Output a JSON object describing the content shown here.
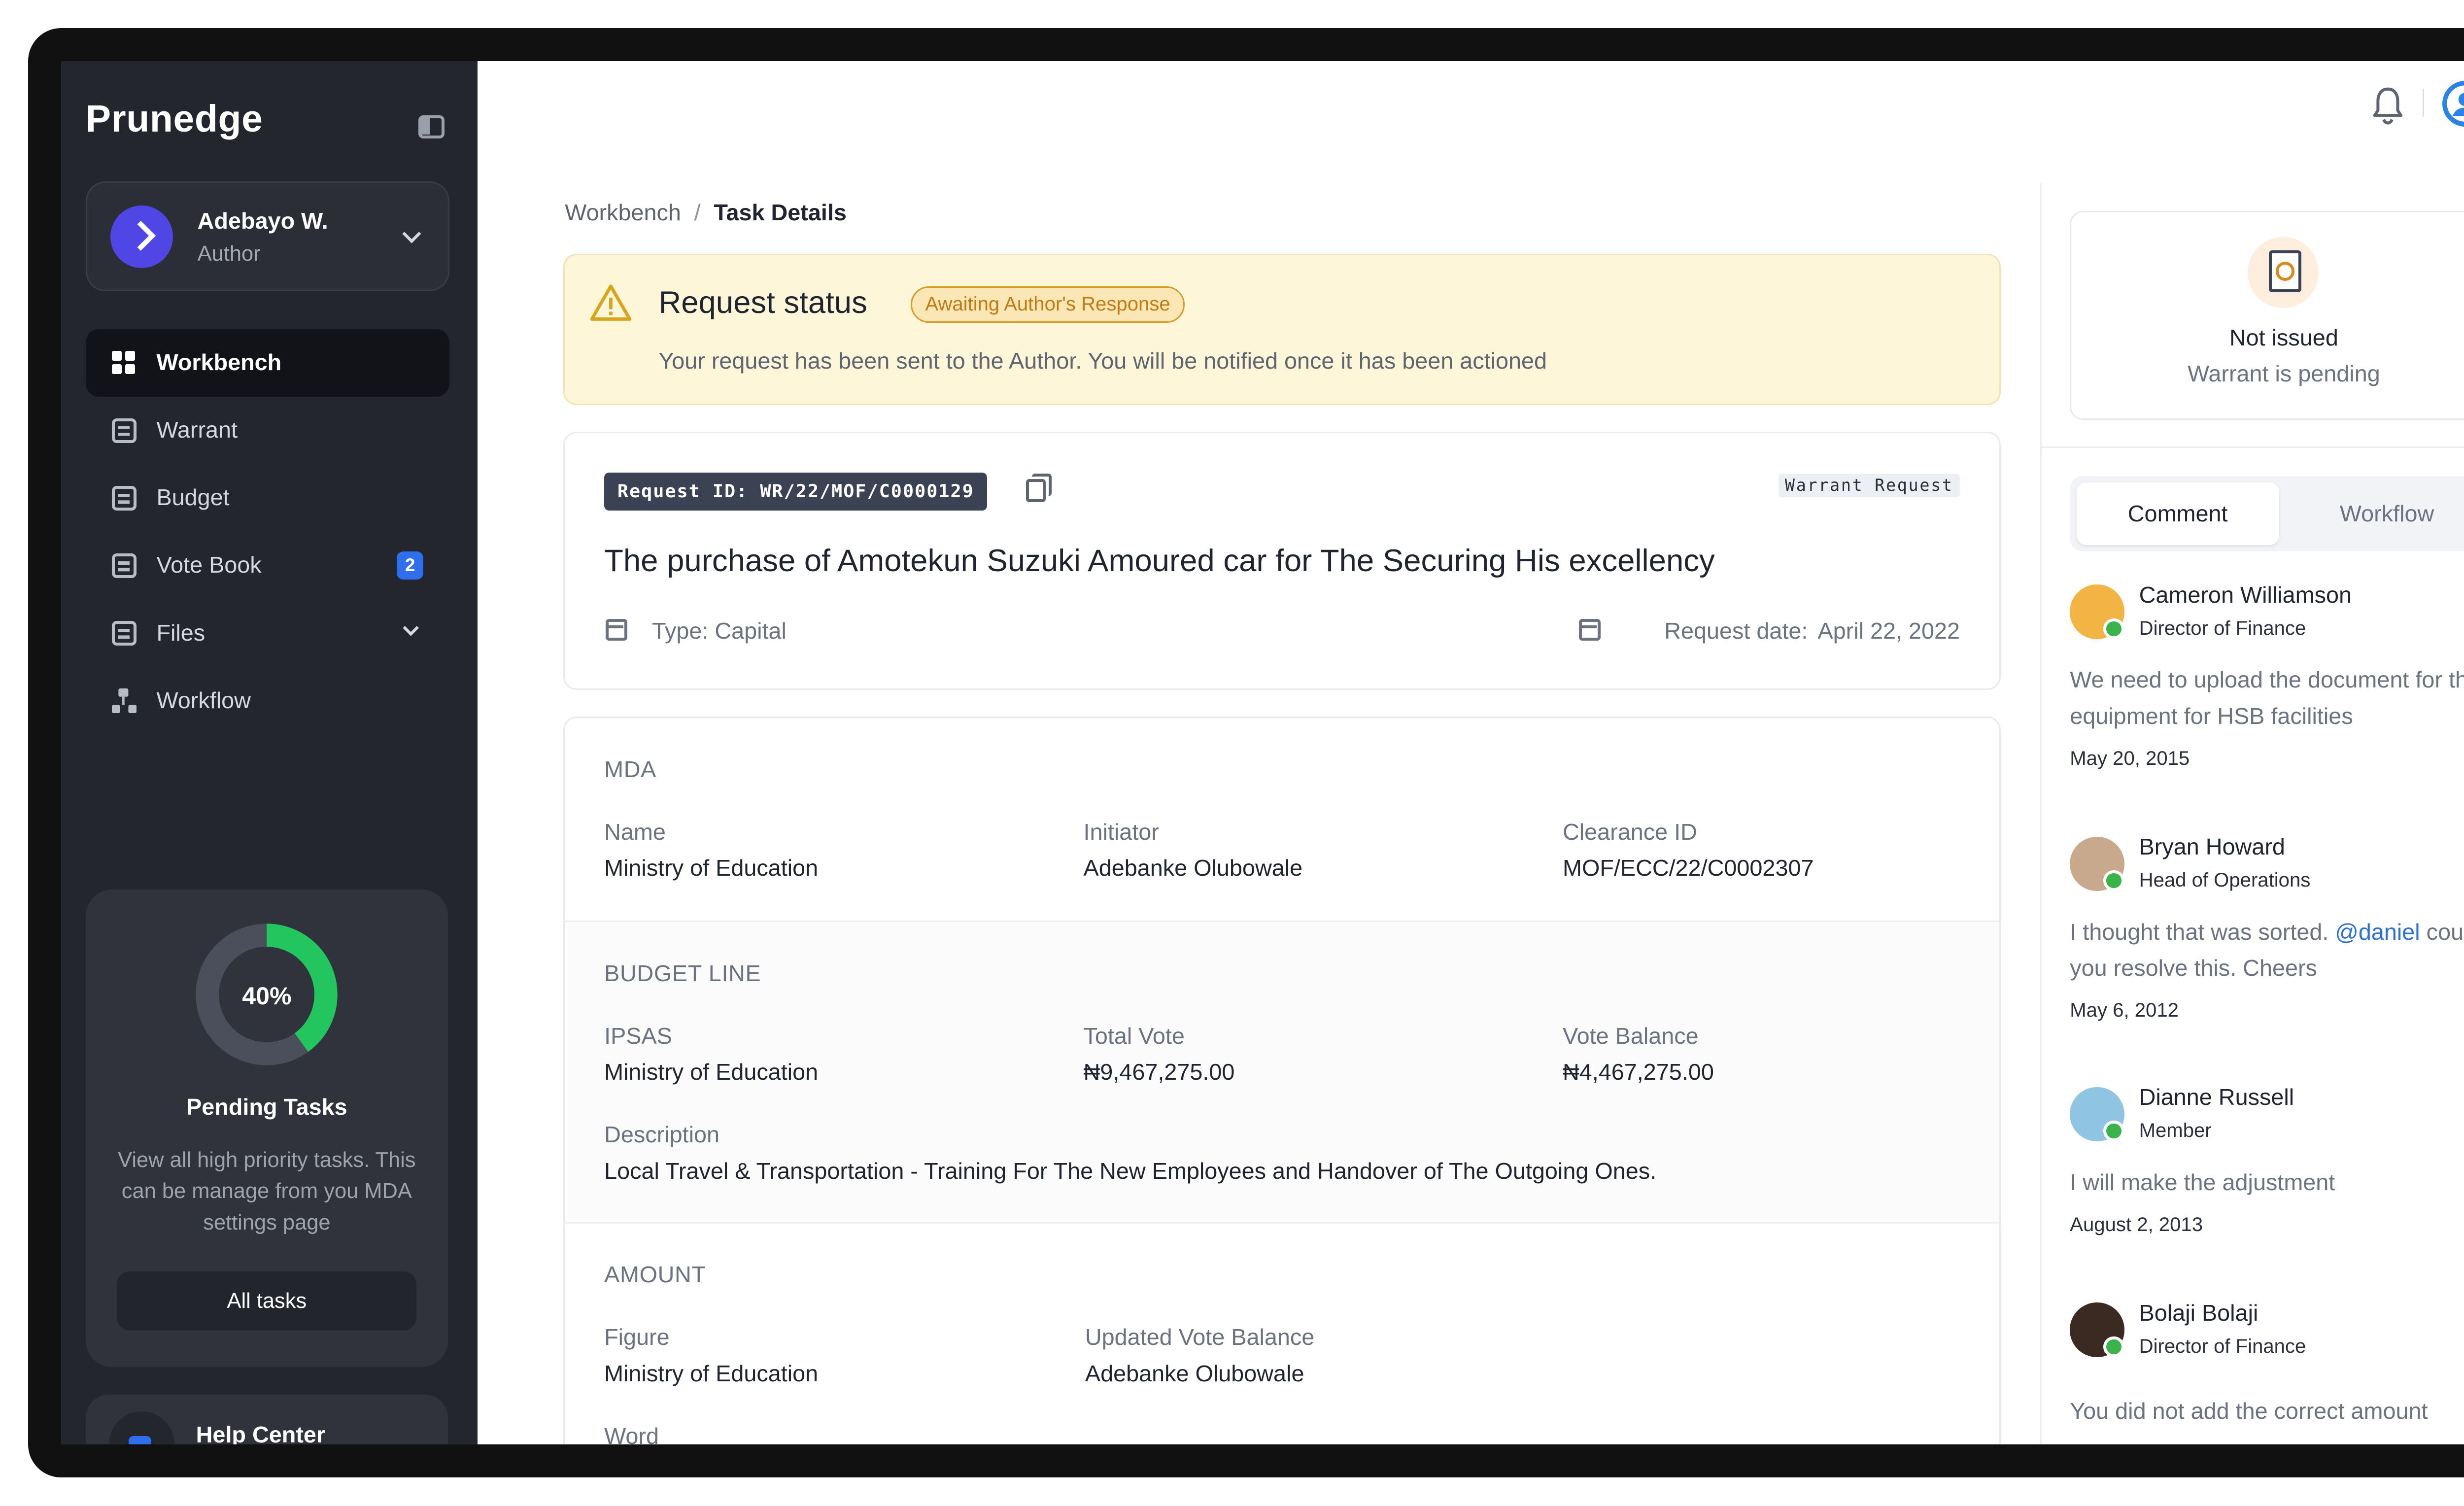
{
  "sidebar": {
    "brand": "Prunedge",
    "user": {
      "name": "Adebayo W.",
      "role": "Author"
    },
    "nav": [
      {
        "label": "Workbench",
        "icon": "grid-icon",
        "active": true
      },
      {
        "label": "Warrant",
        "icon": "list-icon"
      },
      {
        "label": "Budget",
        "icon": "calculator-icon"
      },
      {
        "label": "Vote Book",
        "icon": "vote-book-icon",
        "badge": "2"
      },
      {
        "label": "Files",
        "icon": "files-icon",
        "expandable": true
      },
      {
        "label": "Workflow",
        "icon": "workflow-icon"
      }
    ],
    "tasks": {
      "percent_label": "40%",
      "progress": 0.4,
      "title": "Pending Tasks",
      "description": "View all high priority tasks. This can be manage from you MDA settings page",
      "button": "All tasks"
    },
    "help": "Help Center"
  },
  "header": {
    "bell_icon": "bell-icon",
    "avatar_icon": "user-avatar-icon"
  },
  "breadcrumb": {
    "root": "Workbench",
    "separator": "/",
    "current": "Task Details"
  },
  "status": {
    "title": "Request status",
    "pill": "Awaiting Author's Response",
    "message": "Your request has been sent to the  Author. You will be notified once it has been actioned"
  },
  "request": {
    "id": "Request  ID: WR/22/MOF/C0000129",
    "tag": "Warrant Request",
    "title": "The purchase of Amotekun Suzuki Amoured car for The Securing His excellency",
    "type": "Type: Capital",
    "date_label": "Request date:",
    "date": "April 22, 2022"
  },
  "mda": {
    "title": "MDA",
    "name_label": "Name",
    "name": "Ministry of Education",
    "initiator_label": "Initiator",
    "initiator": "Adebanke Olubowale",
    "clearance_label": "Clearance ID",
    "clearance": "MOF/ECC/22/C0002307"
  },
  "budget": {
    "title": "BUDGET LINE",
    "ipsas_label": "IPSAS",
    "ipsas": "Ministry of Education",
    "total_label": "Total Vote",
    "total": "₦9,467,275.00",
    "balance_label": "Vote Balance",
    "balance": "₦4,467,275.00",
    "desc_label": "Description",
    "desc": "Local Travel & Transportation - Training For The New Employees and Handover of The Outgoing Ones."
  },
  "amount": {
    "title": "AMOUNT",
    "figure_label": "Figure",
    "figure": "Ministry of Education",
    "updated_label": "Updated Vote Balance",
    "updated": "Adebanke Olubowale",
    "word_label": "Word"
  },
  "warrant": {
    "title": "Not issued",
    "subtitle": "Warrant is pending"
  },
  "tabs": [
    "Comment",
    "Workflow"
  ],
  "comments": [
    {
      "name": "Cameron Williamson",
      "role": "Director of Finance",
      "text": "We need to upload the document for the equipment for HSB facilities",
      "date": "May 20, 2015"
    },
    {
      "name": "Bryan Howard",
      "role": "Head of Operations",
      "text_before": "I thought that was sorted. ",
      "mention": "@daniel",
      "text_after": " could you resolve this. Cheers",
      "date": "May 6, 2012"
    },
    {
      "name": "Dianne Russell",
      "role": "Member",
      "text": "I will make the adjustment",
      "date": "August 2, 2013"
    },
    {
      "name": "Bolaji Bolaji",
      "role": "Director of Finance",
      "text": "You did not add the correct amount"
    }
  ],
  "colors": {
    "sidebar_bg": "#24262e",
    "accent_blue": "#2f6fed",
    "progress_green": "#22c55e",
    "status_bg": "#fdf6d9",
    "status_pill": "#c27a12"
  }
}
